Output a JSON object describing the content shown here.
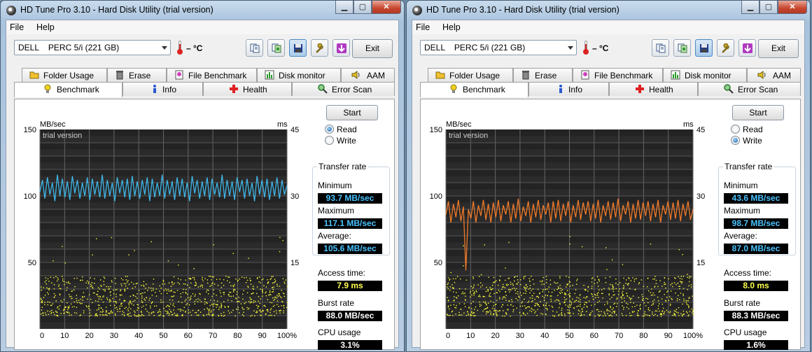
{
  "colors": {
    "read_line": "#3fb6e8",
    "write_line": "#f07a2a",
    "access_points": "#ffff3a",
    "value_blue": "#49c3ff",
    "value_yellow": "#ffff50",
    "value_white": "#ffffff"
  },
  "windows": [
    {
      "title": "HD Tune Pro 3.10 - Hard Disk Utility (trial version)",
      "menu": {
        "file": "File",
        "help": "Help"
      },
      "drive": "DELL    PERC 5/i (221 GB)",
      "temperature": "– °C",
      "exit_label": "Exit",
      "tabs_top": [
        "Folder Usage",
        "Erase",
        "File Benchmark",
        "Disk monitor",
        "AAM"
      ],
      "tabs_bottom": [
        "Benchmark",
        "Info",
        "Health",
        "Error Scan"
      ],
      "selected_tab": "Benchmark",
      "start_label": "Start",
      "mode": {
        "read": "Read",
        "write": "Write",
        "selected": "read"
      },
      "transfer_rate_title": "Transfer rate",
      "labels": {
        "minimum": "Minimum",
        "maximum": "Maximum",
        "average": "Average:",
        "access": "Access time:",
        "burst": "Burst rate",
        "cpu": "CPU usage"
      },
      "values": {
        "minimum": "93.7 MB/sec",
        "maximum": "117.1 MB/sec",
        "average": "105.6 MB/sec",
        "access": "7.9 ms",
        "burst": "88.0 MB/sec",
        "cpu": "3.1%"
      }
    },
    {
      "title": "HD Tune Pro 3.10 - Hard Disk Utility (trial version)",
      "menu": {
        "file": "File",
        "help": "Help"
      },
      "drive": "DELL    PERC 5/i (221 GB)",
      "temperature": "– °C",
      "exit_label": "Exit",
      "tabs_top": [
        "Folder Usage",
        "Erase",
        "File Benchmark",
        "Disk monitor",
        "AAM"
      ],
      "tabs_bottom": [
        "Benchmark",
        "Info",
        "Health",
        "Error Scan"
      ],
      "selected_tab": "Benchmark",
      "start_label": "Start",
      "mode": {
        "read": "Read",
        "write": "Write",
        "selected": "write"
      },
      "transfer_rate_title": "Transfer rate",
      "labels": {
        "minimum": "Minimum",
        "maximum": "Maximum",
        "average": "Average:",
        "access": "Access time:",
        "burst": "Burst rate",
        "cpu": "CPU usage"
      },
      "values": {
        "minimum": "43.6 MB/sec",
        "maximum": "98.7 MB/sec",
        "average": "87.0 MB/sec",
        "access": "8.0 ms",
        "burst": "88.3 MB/sec",
        "cpu": "1.6%"
      }
    }
  ],
  "chart_data": [
    {
      "type": "line",
      "watermark": "trial version",
      "ylabel_left": "MB/sec",
      "ylabel_right": "ms",
      "ylim_left": [
        0,
        150
      ],
      "ylim_right": [
        0,
        45
      ],
      "yticks_left": [
        50,
        100,
        150
      ],
      "yticks_right": [
        15,
        30,
        45
      ],
      "xlim": [
        0,
        100
      ],
      "xticks": [
        "0",
        "10",
        "20",
        "30",
        "40",
        "50",
        "60",
        "70",
        "80",
        "90",
        "100%"
      ],
      "grid": true,
      "series": [
        {
          "values": [
            103,
            112,
            98,
            114,
            101,
            110,
            96,
            116,
            100,
            113,
            99,
            111,
            97,
            115,
            102,
            112,
            98,
            110,
            100,
            114,
            97,
            113,
            101,
            111,
            99,
            116,
            98,
            112,
            100,
            110,
            96,
            114,
            102,
            112,
            99,
            113,
            97,
            115,
            100,
            111,
            98,
            112,
            101,
            114,
            96,
            113,
            99,
            110,
            100,
            116,
            98,
            112,
            101,
            111,
            97,
            114,
            100,
            113,
            99,
            110,
            96,
            115,
            102,
            112,
            98,
            111,
            100,
            114,
            97,
            113,
            101,
            110,
            99,
            116,
            98,
            112,
            100,
            111,
            97,
            114,
            103,
            112,
            98,
            113,
            100,
            110,
            96,
            115,
            101,
            112,
            99,
            113,
            97,
            111,
            100,
            114,
            98,
            112,
            101,
            108
          ]
        },
        {
          "name": "access time",
          "kind": "scatter",
          "range_ms": [
            3,
            12
          ]
        }
      ]
    },
    {
      "type": "line",
      "watermark": "trial version",
      "ylabel_left": "MB/sec",
      "ylabel_right": "ms",
      "ylim_left": [
        0,
        150
      ],
      "ylim_right": [
        0,
        45
      ],
      "yticks_left": [
        50,
        100,
        150
      ],
      "yticks_right": [
        15,
        30,
        45
      ],
      "xlim": [
        0,
        100
      ],
      "xticks": [
        "0",
        "10",
        "20",
        "30",
        "40",
        "50",
        "60",
        "70",
        "80",
        "90",
        "100%"
      ],
      "grid": true,
      "series": [
        {
          "values": [
            86,
            96,
            80,
            94,
            84,
            97,
            81,
            92,
            44,
            90,
            83,
            96,
            80,
            93,
            85,
            97,
            82,
            94,
            80,
            95,
            84,
            97,
            81,
            93,
            86,
            96,
            80,
            94,
            83,
            98,
            81,
            92,
            85,
            96,
            80,
            94,
            84,
            97,
            82,
            93,
            86,
            95,
            80,
            96,
            83,
            97,
            81,
            94,
            85,
            96,
            80,
            93,
            84,
            97,
            82,
            95,
            86,
            96,
            81,
            94,
            83,
            97,
            80,
            93,
            85,
            96,
            82,
            95,
            84,
            98,
            81,
            93,
            86,
            96,
            80,
            94,
            83,
            97,
            82,
            95,
            85,
            96,
            81,
            94,
            84,
            97,
            80,
            93,
            86,
            96,
            82,
            95,
            83,
            97,
            81,
            94,
            85,
            96,
            82,
            90
          ]
        },
        {
          "name": "access time",
          "kind": "scatter",
          "range_ms": [
            3,
            12
          ]
        }
      ]
    }
  ]
}
